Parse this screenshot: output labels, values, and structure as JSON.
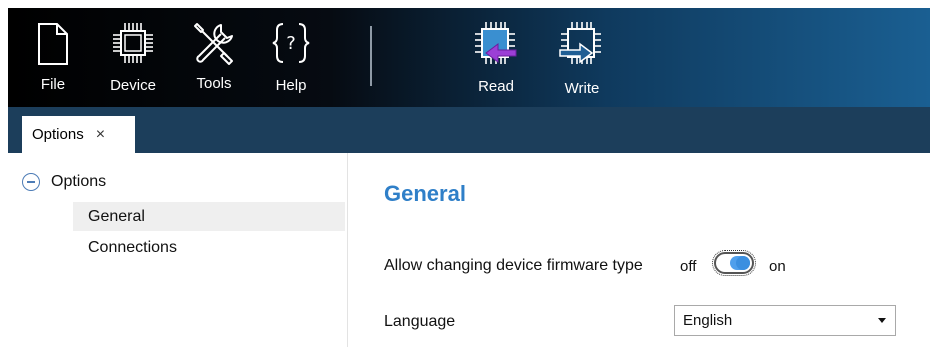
{
  "toolbar": {
    "items": [
      {
        "id": "file",
        "label": "File",
        "icon": "file-icon"
      },
      {
        "id": "device",
        "label": "Device",
        "icon": "chip-icon"
      },
      {
        "id": "tools",
        "label": "Tools",
        "icon": "tools-icon"
      },
      {
        "id": "help",
        "label": "Help",
        "icon": "help-icon"
      }
    ],
    "actions": [
      {
        "id": "read",
        "label": "Read",
        "icon": "read-chip-icon",
        "accent": "#9b3fd6"
      },
      {
        "id": "write",
        "label": "Write",
        "icon": "write-chip-icon"
      }
    ]
  },
  "tabs": [
    {
      "label": "Options",
      "close": "×"
    }
  ],
  "tree": {
    "root": {
      "label": "Options",
      "icon": "collapse-icon"
    },
    "items": [
      {
        "label": "General",
        "selected": true
      },
      {
        "label": "Connections",
        "selected": false
      }
    ]
  },
  "content": {
    "title": "General",
    "firmware": {
      "label": "Allow changing device firmware type",
      "off_label": "off",
      "on_label": "on",
      "value": "on"
    },
    "language": {
      "label": "Language",
      "value": "English"
    }
  },
  "colors": {
    "accent": "#2f7fc8",
    "toggle": "#3b8fe0",
    "tabstrip": "#1c3e5b",
    "read_arrow": "#9b3fd6"
  }
}
